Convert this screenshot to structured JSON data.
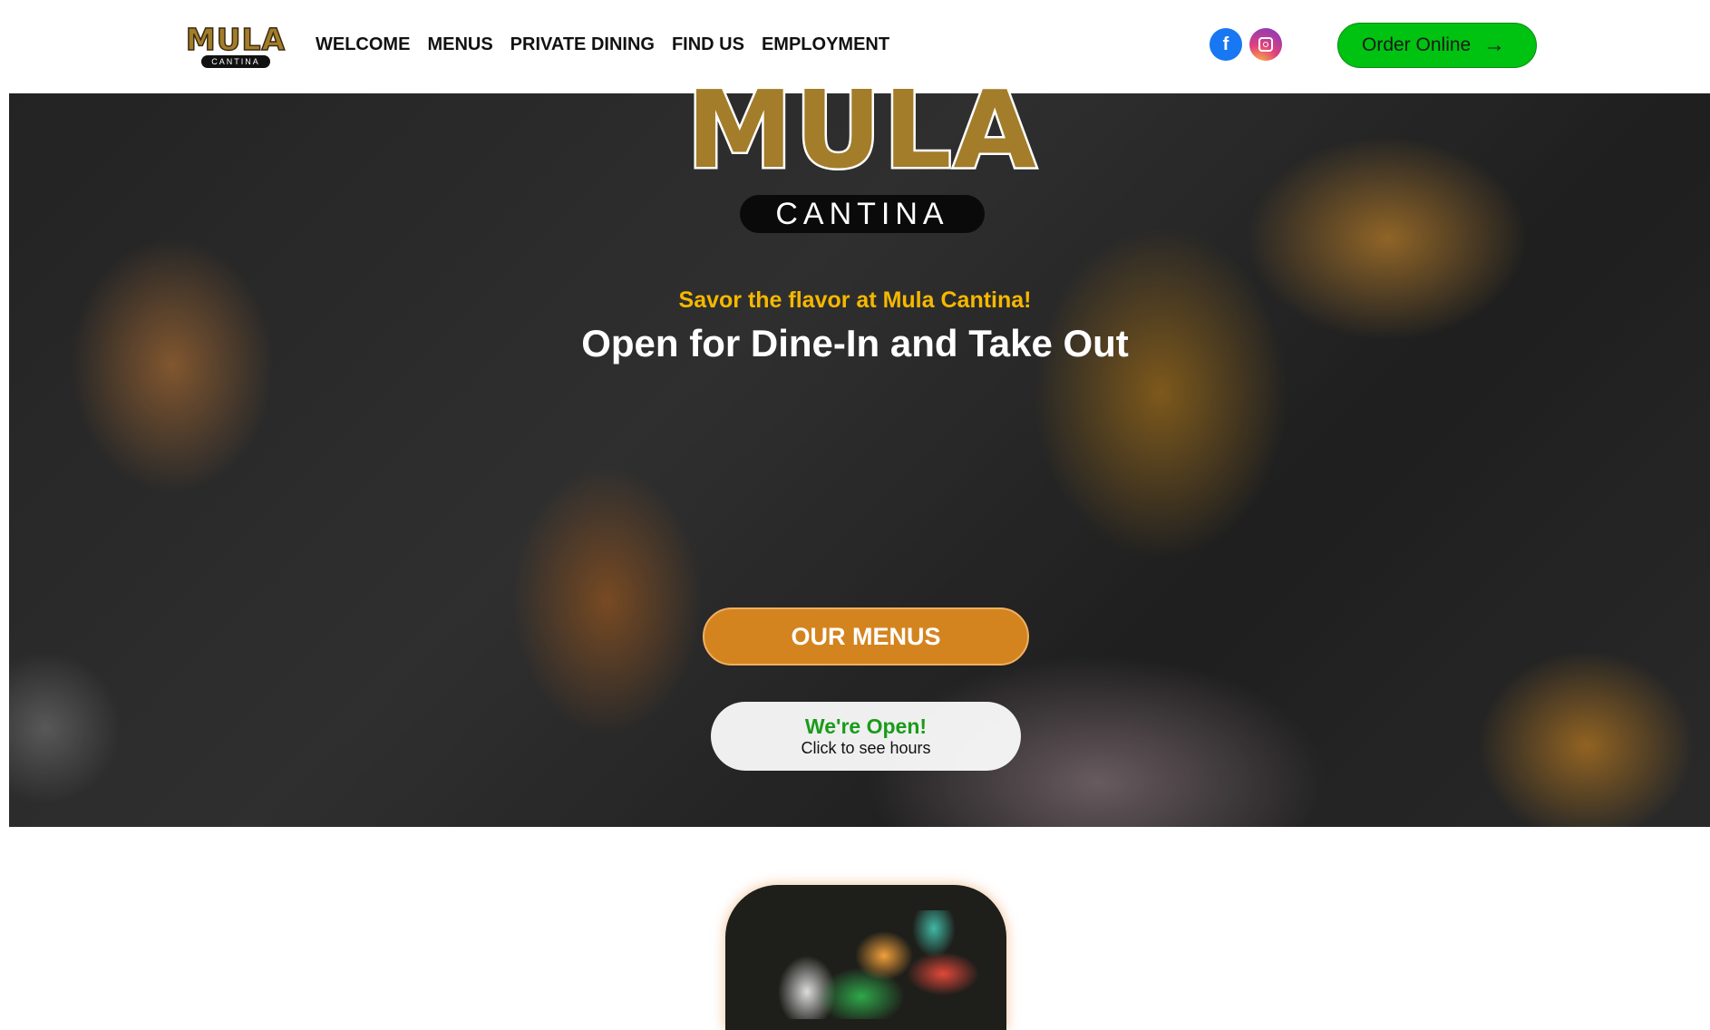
{
  "header": {
    "logo_text": "MULA",
    "logo_sub": "CANTINA",
    "nav": [
      "WELCOME",
      "MENUS",
      "PRIVATE DINING",
      "FIND US",
      "EMPLOYMENT"
    ],
    "social": [
      {
        "icon": "facebook-icon",
        "color": "#1877f2"
      },
      {
        "icon": "instagram-icon",
        "color": "#8a3ab9"
      }
    ],
    "order_label": "Order Online",
    "order_color": "#00c210"
  },
  "hero": {
    "logo_text": "MULA",
    "logo_sub": "CANTINA",
    "tagline": "Savor the flavor at Mula Cantina!",
    "headline": "Open for Dine-In and Take Out",
    "menus_button": "OUR MENUS",
    "open_title": "We're Open!",
    "open_sub": "Click to see hours",
    "accent_color": "#d4841f"
  }
}
